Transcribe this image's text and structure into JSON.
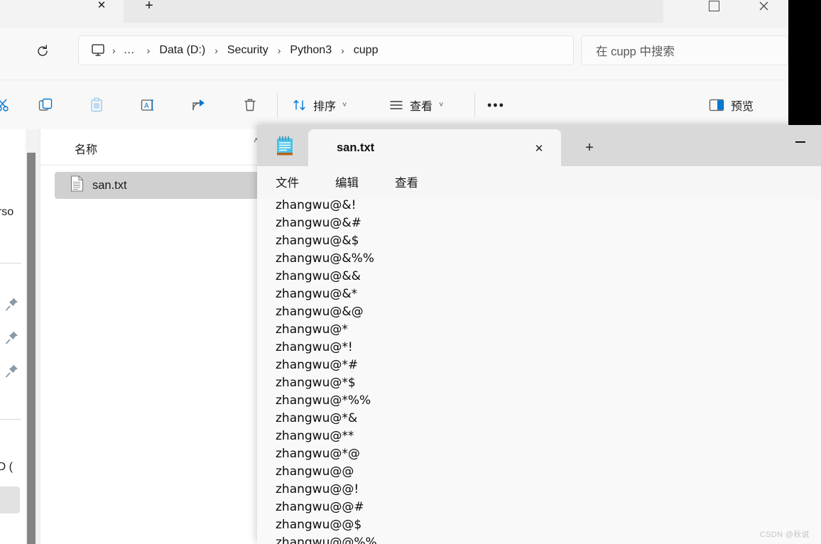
{
  "explorer": {
    "tab": {
      "close_label": "✕",
      "new_tab_label": "+"
    },
    "window_controls": {
      "maximize": "maximize-icon",
      "close": "close-icon"
    },
    "address": {
      "refresh_label": "↻",
      "pc_icon": "this-pc-icon",
      "overflow_label": "…",
      "breadcrumbs": [
        "Data (D:)",
        "Security",
        "Python3",
        "cupp"
      ],
      "separator": "›"
    },
    "search": {
      "placeholder": "在 cupp 中搜索"
    },
    "toolbar": {
      "icons": [
        {
          "name": "cut-icon",
          "glyph": "✂"
        },
        {
          "name": "copy-icon",
          "glyph": "copy"
        },
        {
          "name": "paste-icon",
          "glyph": "paste"
        },
        {
          "name": "rename-icon",
          "glyph": "rename"
        },
        {
          "name": "share-icon",
          "glyph": "share"
        },
        {
          "name": "delete-icon",
          "glyph": "trash"
        }
      ],
      "sort_label": "排序",
      "view_label": "查看",
      "more_label": "•••",
      "preview_label": "预览",
      "chevron": "˅"
    },
    "nav_pane": {
      "partial_items": [
        "erso",
        "SD ("
      ],
      "pin_icon": "pin-icon",
      "pin_count": 3
    },
    "file_list": {
      "column_header": "名称",
      "sort_chevron": "˄",
      "rows": [
        {
          "name": "san.txt",
          "icon": "text-file-icon",
          "selected": true
        }
      ]
    }
  },
  "notepad": {
    "app_icon": "notepad-icon",
    "tab": {
      "title": "san.txt",
      "close_label": "✕"
    },
    "new_tab_label": "+",
    "minimize_label": "minimize-icon",
    "menu": [
      "文件",
      "编辑",
      "查看"
    ],
    "lines": [
      "zhangwu@&!",
      "zhangwu@&#",
      "zhangwu@&$",
      "zhangwu@&%%",
      "zhangwu@&&",
      "zhangwu@&*",
      "zhangwu@&@",
      "zhangwu@*",
      "zhangwu@*!",
      "zhangwu@*#",
      "zhangwu@*$",
      "zhangwu@*%%",
      "zhangwu@*&",
      "zhangwu@**",
      "zhangwu@*@",
      "zhangwu@@",
      "zhangwu@@!",
      "zhangwu@@#",
      "zhangwu@@$",
      "zhangwu@@%%"
    ]
  },
  "watermark": {
    "text": "CSDN @秋说"
  },
  "colors": {
    "accent": "#0078d4",
    "window_bg": "#f8f8f8",
    "selection": "#d0d0d0",
    "notepad_tabstrip": "#d9d9d9"
  }
}
